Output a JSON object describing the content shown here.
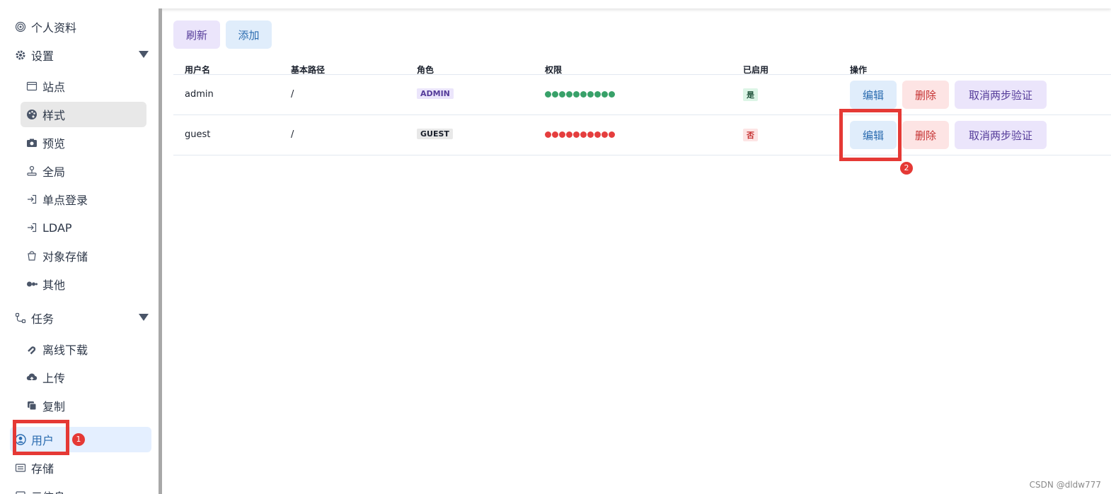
{
  "sidebar": {
    "profile_label": "个人资料",
    "settings": {
      "label": "设置",
      "items": [
        "站点",
        "样式",
        "预览",
        "全局",
        "单点登录",
        "LDAP",
        "对象存储",
        "其他"
      ]
    },
    "tasks": {
      "label": "任务",
      "items": [
        "离线下载",
        "上传",
        "复制"
      ]
    },
    "users_label": "用户",
    "storage_label": "存储",
    "partial_label": "元信息"
  },
  "annotations": {
    "badge_1": "1",
    "badge_2": "2",
    "color": "#e53935"
  },
  "toolbar": {
    "refresh_label": "刷新",
    "add_label": "添加"
  },
  "table": {
    "headers": [
      "用户名",
      "基本路径",
      "角色",
      "权限",
      "已启用",
      "操作"
    ],
    "rows": [
      {
        "username": "admin",
        "base_path": "/",
        "role": "ADMIN",
        "permission_dots": 10,
        "permission_color": "#38a169",
        "enabled": "是",
        "edit": "编辑",
        "delete": "删除",
        "cancel_2fa": "取消两步验证"
      },
      {
        "username": "guest",
        "base_path": "/",
        "role": "GUEST",
        "permission_dots": 10,
        "permission_color": "#e53e3e",
        "enabled": "否",
        "edit": "编辑",
        "delete": "删除",
        "cancel_2fa": "取消两步验证"
      }
    ]
  },
  "watermark": "CSDN @dldw777",
  "colors": {
    "accent": "#2b6cb0",
    "active_bg": "#e4efff",
    "selected_bg": "#e8e8e8"
  }
}
